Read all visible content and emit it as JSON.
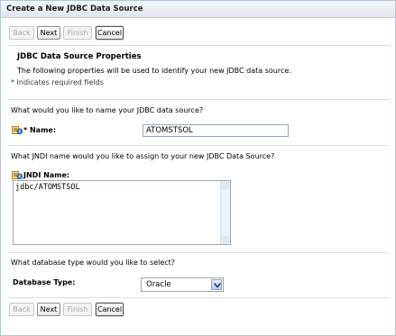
{
  "window": {
    "title": "Create a New JDBC Data Source"
  },
  "buttons": {
    "back": "Back",
    "next": "Next",
    "finish": "Finish",
    "cancel": "Cancel"
  },
  "section": {
    "heading": "JDBC Data Source Properties",
    "description": "The following properties will be used to identify your new JDBC data source.",
    "required_note": "* Indicates required fields"
  },
  "name_field": {
    "question": "What would you like to name your JDBC data source?",
    "label": "* Name:",
    "value": "ATOMSTSOL"
  },
  "jndi_field": {
    "question": "What JNDI name would you like to assign to your new JDBC Data Source?",
    "label": "JNDI Name:",
    "value": "jdbc/ATOMSTSOL"
  },
  "db_type": {
    "question": "What database type would you like to select?",
    "label": "Database Type:",
    "value": "Oracle"
  },
  "icons": {
    "field_help": "help-tooltip-icon"
  }
}
